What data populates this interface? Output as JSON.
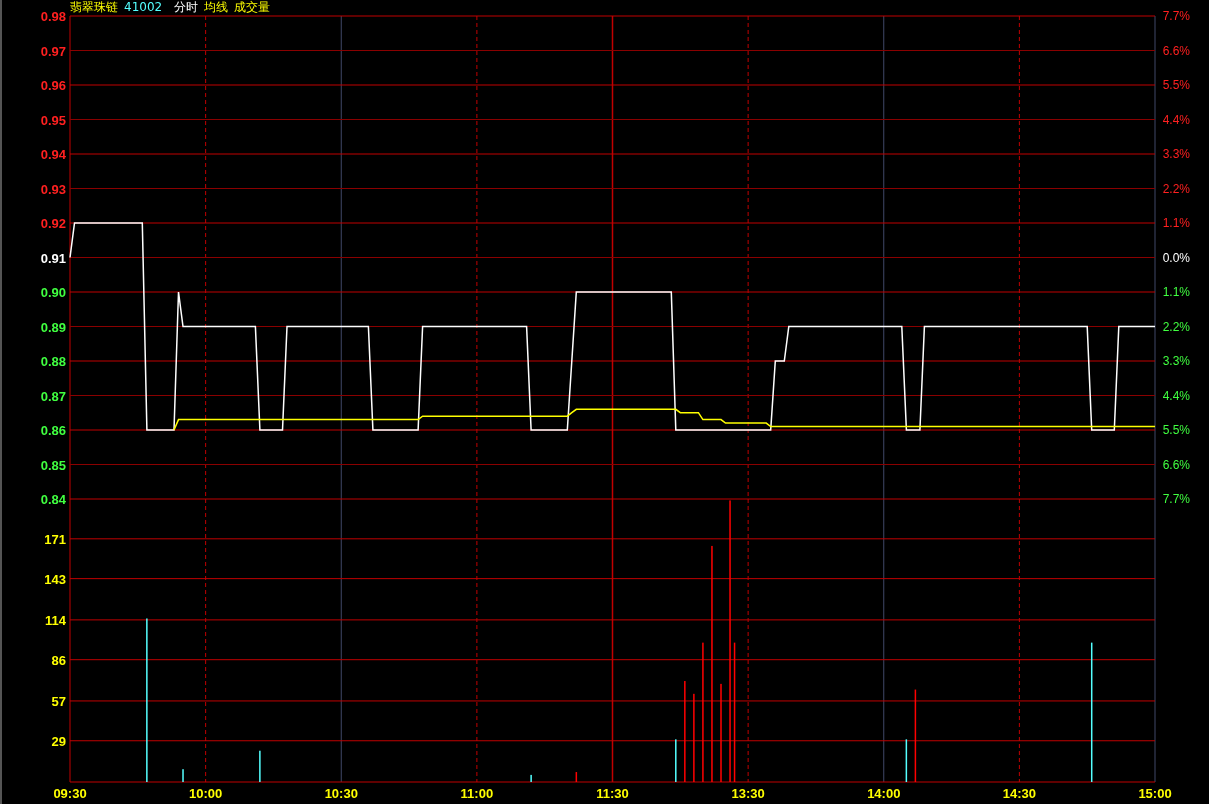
{
  "header": {
    "name": "翡翠珠链",
    "code": "41002"
  },
  "price_chart": {
    "chart_data": {
      "type": "line",
      "grid": true,
      "categories": [
        null,
        null,
        null,
        null,
        null,
        null,
        null,
        null,
        null,
        null,
        null,
        null,
        null,
        null,
        null,
        null,
        null,
        null,
        null,
        null,
        null,
        null,
        null,
        null,
        null,
        null,
        null,
        null,
        null,
        null,
        null,
        null,
        null,
        null,
        null,
        null,
        null,
        null,
        null,
        null,
        null,
        null,
        null,
        null,
        null,
        null,
        null,
        null,
        null,
        null,
        null,
        null,
        null,
        null,
        null,
        null,
        null,
        null,
        null,
        null,
        null,
        null,
        null,
        null,
        null,
        null,
        null,
        null,
        null,
        null,
        null,
        null,
        null,
        null,
        null,
        null,
        null,
        null,
        null,
        null,
        null,
        null,
        null,
        null,
        null,
        null,
        null,
        null,
        null,
        null,
        null,
        null,
        null,
        null,
        null,
        null,
        null,
        null,
        null,
        null,
        null,
        null,
        null,
        null,
        null,
        null,
        null,
        null,
        null,
        null,
        null,
        null,
        null,
        null,
        null,
        null,
        null,
        null,
        null,
        null,
        null,
        null,
        null,
        null,
        null,
        null,
        null,
        null,
        null,
        null,
        null,
        null,
        null,
        null,
        null,
        null,
        null,
        null,
        null,
        null,
        null,
        null,
        null,
        null,
        null,
        null,
        null,
        null,
        null,
        null,
        null,
        null,
        null,
        null,
        null,
        null,
        null,
        null,
        null,
        null,
        null,
        null,
        null,
        null,
        null,
        null,
        null,
        null,
        null,
        null,
        null,
        null,
        null,
        null,
        null,
        null,
        null,
        null,
        null,
        null,
        null,
        null,
        null,
        null,
        null,
        null,
        null,
        null,
        null,
        null,
        null,
        null,
        null,
        null,
        null,
        null,
        null,
        null,
        null,
        null,
        null,
        null,
        null,
        null,
        null,
        null,
        null,
        null,
        null,
        null,
        null,
        null,
        null,
        null,
        null,
        null,
        null,
        null,
        null,
        null,
        null,
        null,
        null,
        null,
        null,
        null,
        null,
        null,
        null,
        null,
        null,
        null,
        null,
        null,
        null,
        null,
        null,
        null,
        null,
        null,
        null
      ],
      "series": [
        {
          "name": "分时",
          "color": "#ffffff",
          "values": [
            0.91,
            0.92,
            0.92,
            0.92,
            0.92,
            0.92,
            0.92,
            0.92,
            0.92,
            0.92,
            0.92,
            0.92,
            0.92,
            0.92,
            0.92,
            0.92,
            0.92,
            0.86,
            0.86,
            0.86,
            0.86,
            0.86,
            0.86,
            0.86,
            0.9,
            0.89,
            0.89,
            0.89,
            0.89,
            0.89,
            0.89,
            0.89,
            0.89,
            0.89,
            0.89,
            0.89,
            0.89,
            0.89,
            0.89,
            0.89,
            0.89,
            0.89,
            0.86,
            0.86,
            0.86,
            0.86,
            0.86,
            0.86,
            0.89,
            0.89,
            0.89,
            0.89,
            0.89,
            0.89,
            0.89,
            0.89,
            0.89,
            0.89,
            0.89,
            0.89,
            0.89,
            0.89,
            0.89,
            0.89,
            0.89,
            0.89,
            0.89,
            0.86,
            0.86,
            0.86,
            0.86,
            0.86,
            0.86,
            0.86,
            0.86,
            0.86,
            0.86,
            0.86,
            0.89,
            0.89,
            0.89,
            0.89,
            0.89,
            0.89,
            0.89,
            0.89,
            0.89,
            0.89,
            0.89,
            0.89,
            0.89,
            0.89,
            0.89,
            0.89,
            0.89,
            0.89,
            0.89,
            0.89,
            0.89,
            0.89,
            0.89,
            0.89,
            0.86,
            0.86,
            0.86,
            0.86,
            0.86,
            0.86,
            0.86,
            0.86,
            0.86,
            0.88,
            0.9,
            0.9,
            0.9,
            0.9,
            0.9,
            0.9,
            0.9,
            0.9,
            0.9,
            0.9,
            0.9,
            0.9,
            0.9,
            0.9,
            0.9,
            0.9,
            0.9,
            0.9,
            0.9,
            0.9,
            0.9,
            0.9,
            0.86,
            0.86,
            0.86,
            0.86,
            0.86,
            0.86,
            0.86,
            0.86,
            0.86,
            0.86,
            0.86,
            0.86,
            0.86,
            0.86,
            0.86,
            0.86,
            0.86,
            0.86,
            0.86,
            0.86,
            0.86,
            0.86,
            0.88,
            0.88,
            0.88,
            0.89,
            0.89,
            0.89,
            0.89,
            0.89,
            0.89,
            0.89,
            0.89,
            0.89,
            0.89,
            0.89,
            0.89,
            0.89,
            0.89,
            0.89,
            0.89,
            0.89,
            0.89,
            0.89,
            0.89,
            0.89,
            0.89,
            0.89,
            0.89,
            0.89,
            0.89,
            0.86,
            0.86,
            0.86,
            0.86,
            0.89,
            0.89,
            0.89,
            0.89,
            0.89,
            0.89,
            0.89,
            0.89,
            0.89,
            0.89,
            0.89,
            0.89,
            0.89,
            0.89,
            0.89,
            0.89,
            0.89,
            0.89,
            0.89,
            0.89,
            0.89,
            0.89,
            0.89,
            0.89,
            0.89,
            0.89,
            0.89,
            0.89,
            0.89,
            0.89,
            0.89,
            0.89,
            0.89,
            0.89,
            0.89,
            0.89,
            0.89,
            0.86,
            0.86,
            0.86,
            0.86,
            0.86,
            0.86,
            0.89,
            0.89,
            0.89,
            0.89,
            0.89,
            0.89,
            0.89,
            0.89,
            0.89
          ]
        },
        {
          "name": "均线",
          "color": "#ffff00",
          "values": [
            null,
            null,
            null,
            null,
            null,
            null,
            null,
            null,
            null,
            null,
            null,
            null,
            null,
            null,
            null,
            null,
            null,
            null,
            null,
            null,
            null,
            null,
            null,
            0.86,
            0.863,
            0.863,
            0.863,
            0.863,
            0.863,
            0.863,
            0.863,
            0.863,
            0.863,
            0.863,
            0.863,
            0.863,
            0.863,
            0.863,
            0.863,
            0.863,
            0.863,
            0.863,
            0.863,
            0.863,
            0.863,
            0.863,
            0.863,
            0.863,
            0.863,
            0.863,
            0.863,
            0.863,
            0.863,
            0.863,
            0.863,
            0.863,
            0.863,
            0.863,
            0.863,
            0.863,
            0.863,
            0.863,
            0.863,
            0.863,
            0.863,
            0.863,
            0.863,
            0.863,
            0.863,
            0.863,
            0.863,
            0.863,
            0.863,
            0.863,
            0.863,
            0.863,
            0.863,
            0.863,
            0.864,
            0.864,
            0.864,
            0.864,
            0.864,
            0.864,
            0.864,
            0.864,
            0.864,
            0.864,
            0.864,
            0.864,
            0.864,
            0.864,
            0.864,
            0.864,
            0.864,
            0.864,
            0.864,
            0.864,
            0.864,
            0.864,
            0.864,
            0.864,
            0.864,
            0.864,
            0.864,
            0.864,
            0.864,
            0.864,
            0.864,
            0.864,
            0.864,
            0.865,
            0.866,
            0.866,
            0.866,
            0.866,
            0.866,
            0.866,
            0.866,
            0.866,
            0.866,
            0.866,
            0.866,
            0.866,
            0.866,
            0.866,
            0.866,
            0.866,
            0.866,
            0.866,
            0.866,
            0.866,
            0.866,
            0.866,
            0.866,
            0.865,
            0.865,
            0.865,
            0.865,
            0.865,
            0.863,
            0.863,
            0.863,
            0.863,
            0.863,
            0.862,
            0.862,
            0.862,
            0.862,
            0.862,
            0.862,
            0.862,
            0.862,
            0.862,
            0.862,
            0.861,
            0.861,
            0.861,
            0.861,
            0.861,
            0.861,
            0.861,
            0.861,
            0.861,
            0.861,
            0.861,
            0.861,
            0.861,
            0.861,
            0.861,
            0.861,
            0.861,
            0.861,
            0.861,
            0.861,
            0.861,
            0.861,
            0.861,
            0.861,
            0.861,
            0.861,
            0.861,
            0.861,
            0.861,
            0.861,
            0.861,
            0.861,
            0.861,
            0.861,
            0.861,
            0.861,
            0.861,
            0.861,
            0.861,
            0.861,
            0.861,
            0.861,
            0.861,
            0.861,
            0.861,
            0.861,
            0.861,
            0.861,
            0.861,
            0.861,
            0.861,
            0.861,
            0.861,
            0.861,
            0.861,
            0.861,
            0.861,
            0.861,
            0.861,
            0.861,
            0.861,
            0.861,
            0.861,
            0.861,
            0.861,
            0.861,
            0.861,
            0.861,
            0.861,
            0.861,
            0.861,
            0.861,
            0.861,
            0.861,
            0.861,
            0.861,
            0.861,
            0.861,
            0.861,
            0.861,
            0.861,
            0.861,
            0.861,
            0.861,
            0.861,
            0.861
          ]
        }
      ],
      "ylim": [
        0.84,
        0.98
      ],
      "yticks": [
        {
          "value": 0.98,
          "label": "0.98"
        },
        {
          "value": 0.97,
          "label": "0.97"
        },
        {
          "value": 0.96,
          "label": "0.96"
        },
        {
          "value": 0.95,
          "label": "0.95"
        },
        {
          "value": 0.94,
          "label": "0.94"
        },
        {
          "value": 0.93,
          "label": "0.93"
        },
        {
          "value": 0.92,
          "label": "0.92"
        },
        {
          "value": 0.91,
          "label": "0.91"
        },
        {
          "value": 0.9,
          "label": "0.90"
        },
        {
          "value": 0.89,
          "label": "0.89"
        },
        {
          "value": 0.88,
          "label": "0.88"
        },
        {
          "value": 0.87,
          "label": "0.87"
        },
        {
          "value": 0.86,
          "label": "0.86"
        },
        {
          "value": 0.85,
          "label": "0.85"
        },
        {
          "value": 0.84,
          "label": "0.84"
        }
      ]
    },
    "percent_axis": [
      {
        "label": "7.7%",
        "color": "#ff2020"
      },
      {
        "label": "6.6%",
        "color": "#ff2020"
      },
      {
        "label": "5.5%",
        "color": "#ff2020"
      },
      {
        "label": "4.4%",
        "color": "#ff2020"
      },
      {
        "label": "3.3%",
        "color": "#ff2020"
      },
      {
        "label": "2.2%",
        "color": "#ff2020"
      },
      {
        "label": "1.1%",
        "color": "#ff2020"
      },
      {
        "label": "0.0%",
        "color": "#ffffff"
      },
      {
        "label": "1.1%",
        "color": "#40ff40"
      },
      {
        "label": "2.2%",
        "color": "#40ff40"
      },
      {
        "label": "3.3%",
        "color": "#40ff40"
      },
      {
        "label": "4.4%",
        "color": "#40ff40"
      },
      {
        "label": "5.5%",
        "color": "#40ff40"
      },
      {
        "label": "6.6%",
        "color": "#40ff40"
      },
      {
        "label": "7.7%",
        "color": "#40ff40"
      }
    ]
  },
  "volume_chart": {
    "chart_data": {
      "type": "bar",
      "title": "成交量",
      "grid": true,
      "categories": [
        "09:30",
        null,
        null,
        null,
        null,
        null,
        null,
        null,
        null,
        null,
        null,
        null,
        null,
        null,
        null,
        null,
        null,
        null,
        null,
        null,
        null,
        null,
        null,
        null,
        null,
        null,
        null,
        null,
        null,
        null,
        "10:00",
        null,
        null,
        null,
        null,
        null,
        null,
        null,
        null,
        null,
        null,
        null,
        null,
        null,
        null,
        null,
        null,
        null,
        null,
        null,
        null,
        null,
        null,
        null,
        null,
        null,
        null,
        null,
        null,
        null,
        "10:30",
        null,
        null,
        null,
        null,
        null,
        null,
        null,
        null,
        null,
        null,
        null,
        null,
        null,
        null,
        null,
        null,
        null,
        null,
        null,
        null,
        null,
        null,
        null,
        null,
        null,
        null,
        null,
        null,
        null,
        "11:00",
        null,
        null,
        null,
        null,
        null,
        null,
        null,
        null,
        null,
        null,
        null,
        null,
        null,
        null,
        null,
        null,
        null,
        null,
        null,
        null,
        null,
        null,
        null,
        null,
        null,
        null,
        null,
        null,
        null,
        "11:30",
        null,
        null,
        null,
        null,
        null,
        null,
        null,
        null,
        null,
        null,
        null,
        null,
        null,
        null,
        null,
        null,
        null,
        null,
        null,
        null,
        null,
        null,
        null,
        null,
        null,
        null,
        null,
        null,
        null,
        "13:30",
        null,
        null,
        null,
        null,
        null,
        null,
        null,
        null,
        null,
        null,
        null,
        null,
        null,
        null,
        null,
        null,
        null,
        null,
        null,
        null,
        null,
        null,
        null,
        null,
        null,
        null,
        null,
        null,
        null,
        "14:00",
        null,
        null,
        null,
        null,
        null,
        null,
        null,
        null,
        null,
        null,
        null,
        null,
        null,
        null,
        null,
        null,
        null,
        null,
        null,
        null,
        null,
        null,
        null,
        null,
        null,
        null,
        null,
        null,
        null,
        "14:30",
        null,
        null,
        null,
        null,
        null,
        null,
        null,
        null,
        null,
        null,
        null,
        null,
        null,
        null,
        null,
        null,
        null,
        null,
        null,
        null,
        null,
        null,
        null,
        null,
        null,
        null,
        null,
        null,
        null,
        "15:00"
      ],
      "series": [
        {
          "color": "#ff0000",
          "values": [
            null,
            null,
            null,
            null,
            null,
            null,
            null,
            null,
            null,
            null,
            null,
            null,
            null,
            null,
            null,
            null,
            null,
            null,
            null,
            null,
            null,
            null,
            null,
            null,
            null,
            null,
            null,
            null,
            null,
            null,
            null,
            null,
            null,
            null,
            null,
            null,
            null,
            null,
            null,
            null,
            null,
            null,
            null,
            null,
            null,
            null,
            null,
            null,
            null,
            null,
            null,
            null,
            null,
            null,
            null,
            null,
            null,
            null,
            null,
            null,
            null,
            null,
            null,
            null,
            null,
            null,
            null,
            null,
            null,
            null,
            null,
            null,
            null,
            null,
            null,
            null,
            null,
            null,
            null,
            null,
            null,
            null,
            null,
            null,
            null,
            null,
            null,
            null,
            null,
            null,
            null,
            null,
            null,
            null,
            null,
            null,
            null,
            null,
            null,
            null,
            null,
            null,
            null,
            null,
            null,
            null,
            null,
            null,
            null,
            null,
            null,
            null,
            7,
            null,
            null,
            null,
            null,
            null,
            null,
            null,
            null,
            null,
            null,
            null,
            null,
            null,
            null,
            null,
            null,
            null,
            null,
            null,
            null,
            null,
            null,
            null,
            71,
            null,
            62,
            null,
            98,
            null,
            166,
            null,
            69,
            null,
            198,
            98,
            null,
            null,
            null,
            null,
            null,
            null,
            null,
            null,
            null,
            null,
            null,
            null,
            null,
            null,
            null,
            null,
            null,
            null,
            null,
            null,
            null,
            null,
            null,
            null,
            null,
            null,
            null,
            null,
            null,
            null,
            null,
            null,
            null,
            null,
            null,
            null,
            null,
            null,
            null,
            65,
            null,
            null,
            null,
            null,
            null,
            null,
            null,
            null,
            null,
            null,
            null,
            null,
            null,
            null,
            null,
            null,
            null,
            null,
            null,
            null,
            null,
            null,
            null,
            null,
            null,
            null,
            null,
            null,
            null,
            null,
            null,
            null,
            null,
            null,
            null,
            null,
            null,
            null,
            null,
            null,
            null,
            null,
            null,
            null,
            null,
            null,
            null,
            null,
            null,
            null,
            null,
            null,
            null
          ]
        },
        {
          "color": "#54ffff",
          "values": [
            null,
            null,
            null,
            null,
            null,
            null,
            null,
            null,
            null,
            null,
            null,
            null,
            null,
            null,
            null,
            null,
            null,
            115,
            null,
            null,
            null,
            null,
            null,
            null,
            null,
            9,
            null,
            null,
            null,
            null,
            null,
            null,
            null,
            null,
            null,
            null,
            null,
            null,
            null,
            null,
            null,
            null,
            22,
            null,
            null,
            null,
            null,
            null,
            null,
            null,
            null,
            null,
            null,
            null,
            null,
            null,
            null,
            null,
            null,
            null,
            null,
            null,
            null,
            null,
            null,
            null,
            null,
            null,
            null,
            null,
            null,
            null,
            null,
            null,
            null,
            null,
            null,
            null,
            null,
            null,
            null,
            null,
            null,
            null,
            null,
            null,
            null,
            null,
            null,
            null,
            null,
            null,
            null,
            null,
            null,
            null,
            null,
            null,
            null,
            null,
            null,
            null,
            5,
            null,
            null,
            null,
            null,
            null,
            null,
            null,
            null,
            null,
            null,
            null,
            null,
            null,
            null,
            null,
            null,
            null,
            null,
            null,
            null,
            null,
            null,
            null,
            null,
            null,
            null,
            null,
            null,
            null,
            null,
            null,
            30,
            null,
            null,
            null,
            null,
            null,
            null,
            null,
            null,
            null,
            null,
            null,
            null,
            null,
            null,
            null,
            null,
            null,
            null,
            null,
            null,
            null,
            null,
            null,
            null,
            null,
            null,
            null,
            null,
            null,
            null,
            null,
            null,
            null,
            null,
            null,
            null,
            null,
            null,
            null,
            null,
            null,
            null,
            null,
            null,
            null,
            null,
            null,
            null,
            null,
            null,
            30,
            null,
            null,
            null,
            null,
            null,
            null,
            null,
            null,
            null,
            null,
            null,
            null,
            null,
            null,
            null,
            null,
            null,
            null,
            null,
            null,
            null,
            null,
            null,
            null,
            null,
            null,
            null,
            null,
            null,
            null,
            null,
            null,
            null,
            null,
            null,
            null,
            null,
            null,
            null,
            null,
            98,
            null,
            null,
            null,
            null,
            null,
            null,
            null,
            null,
            null,
            null,
            null,
            null,
            null,
            null
          ]
        }
      ],
      "ylim": [
        0,
        199
      ],
      "yticks": [
        29,
        57,
        86,
        114,
        143,
        171
      ]
    }
  }
}
